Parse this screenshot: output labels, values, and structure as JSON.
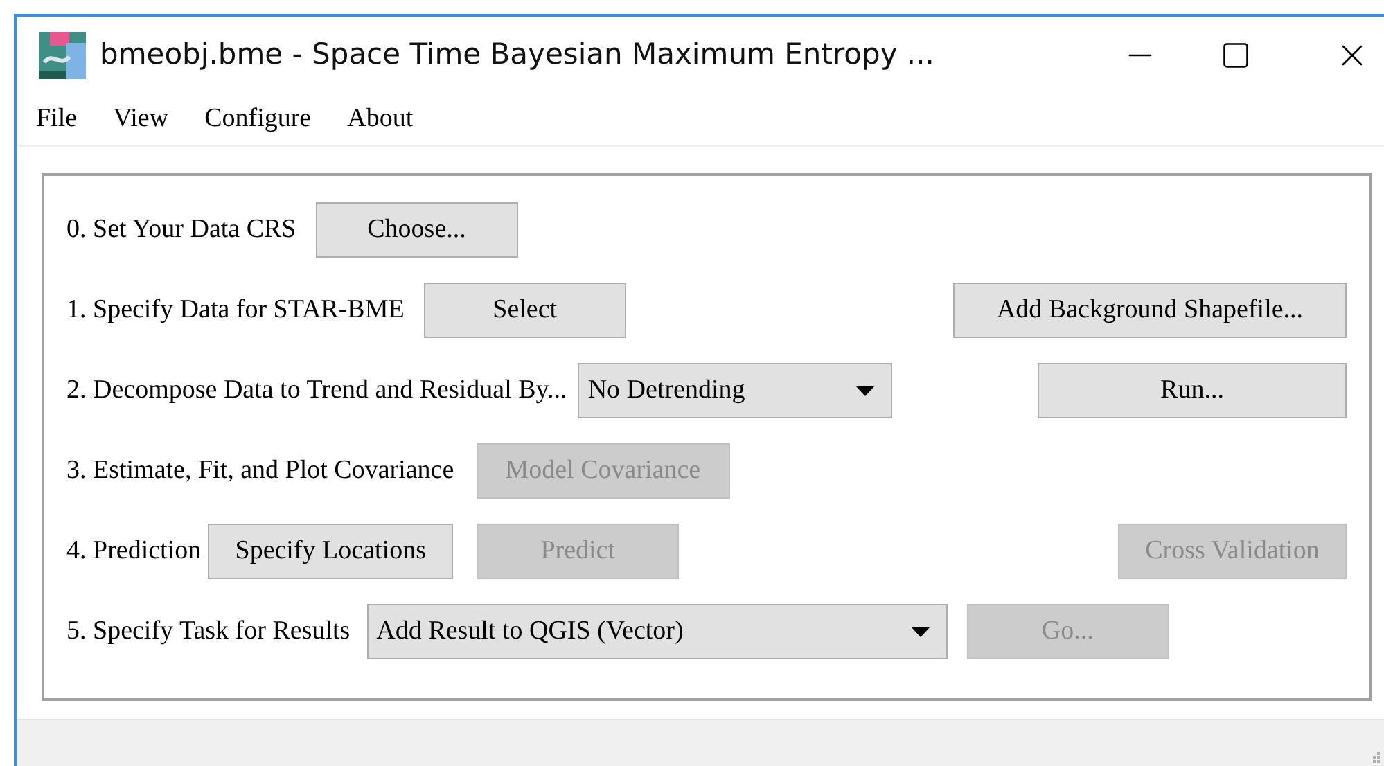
{
  "window": {
    "title": "bmeobj.bme - Space Time Bayesian Maximum Entropy ..."
  },
  "menu": [
    "File",
    "View",
    "Configure",
    "About"
  ],
  "steps": [
    {
      "label": "0. Set Your Data CRS",
      "controls": [
        {
          "kind": "button",
          "text": "Choose...",
          "disabled": false
        }
      ]
    },
    {
      "label": "1. Specify Data for STAR-BME",
      "controls": [
        {
          "kind": "button",
          "text": "Select",
          "disabled": false
        },
        {
          "kind": "button",
          "text": "Add Background Shapefile...",
          "disabled": false
        }
      ]
    },
    {
      "label": "2. Decompose Data to Trend and Residual By...",
      "controls": [
        {
          "kind": "dropdown",
          "text": "No Detrending",
          "disabled": false
        },
        {
          "kind": "button",
          "text": "Run...",
          "disabled": false
        }
      ]
    },
    {
      "label": "3. Estimate, Fit, and Plot Covariance",
      "controls": [
        {
          "kind": "button",
          "text": "Model Covariance",
          "disabled": true
        }
      ]
    },
    {
      "label": "4. Prediction",
      "controls": [
        {
          "kind": "button",
          "text": "Specify Locations",
          "disabled": false
        },
        {
          "kind": "button",
          "text": "Predict",
          "disabled": true
        },
        {
          "kind": "button",
          "text": "Cross Validation",
          "disabled": true
        }
      ]
    },
    {
      "label": "5. Specify Task for Results",
      "controls": [
        {
          "kind": "dropdown",
          "text": "Add Result to QGIS (Vector)",
          "disabled": false
        },
        {
          "kind": "button",
          "text": "Go...",
          "disabled": true
        }
      ]
    }
  ]
}
